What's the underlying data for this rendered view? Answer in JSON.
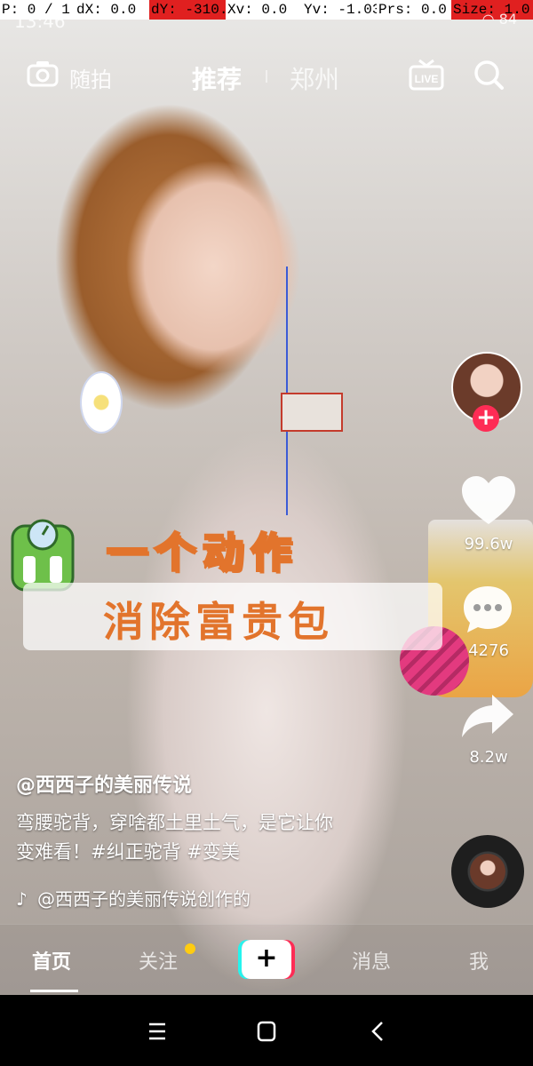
{
  "debug": {
    "p": "P: 0 / 1",
    "dx": "dX: 0.0",
    "dy": "dY: -310.0",
    "xv": "Xv: 0.0",
    "yv": "Yv: -1.032",
    "prs": "Prs: 0.0",
    "size": "Size: 1.0"
  },
  "status": {
    "time": "13:46",
    "battery": "84"
  },
  "top_nav": {
    "camera_label": "随拍",
    "tab_recommend": "推荐",
    "tab_city": "郑州",
    "live_label": "LIVE"
  },
  "sticker": {
    "line1": "一个动作",
    "line2": "消除富贵包"
  },
  "rail": {
    "likes": "99.6w",
    "comments": "4276",
    "shares": "8.2w"
  },
  "post": {
    "author": "@西西子的美丽传说",
    "desc_line1": "弯腰驼背，穿啥都土里土气，是它让你",
    "desc_line2": "变难看！#纠正驼背 #变美",
    "music": "@西西子的美丽传说创作的"
  },
  "tabs": {
    "home": "首页",
    "follow": "关注",
    "plus": "+",
    "messages": "消息",
    "me": "我"
  },
  "colors": {
    "accent_pink": "#fe2c55",
    "accent_cyan": "#25f4ee",
    "sticker_orange": "#e2742c",
    "badge_yellow": "#ffcc11"
  }
}
